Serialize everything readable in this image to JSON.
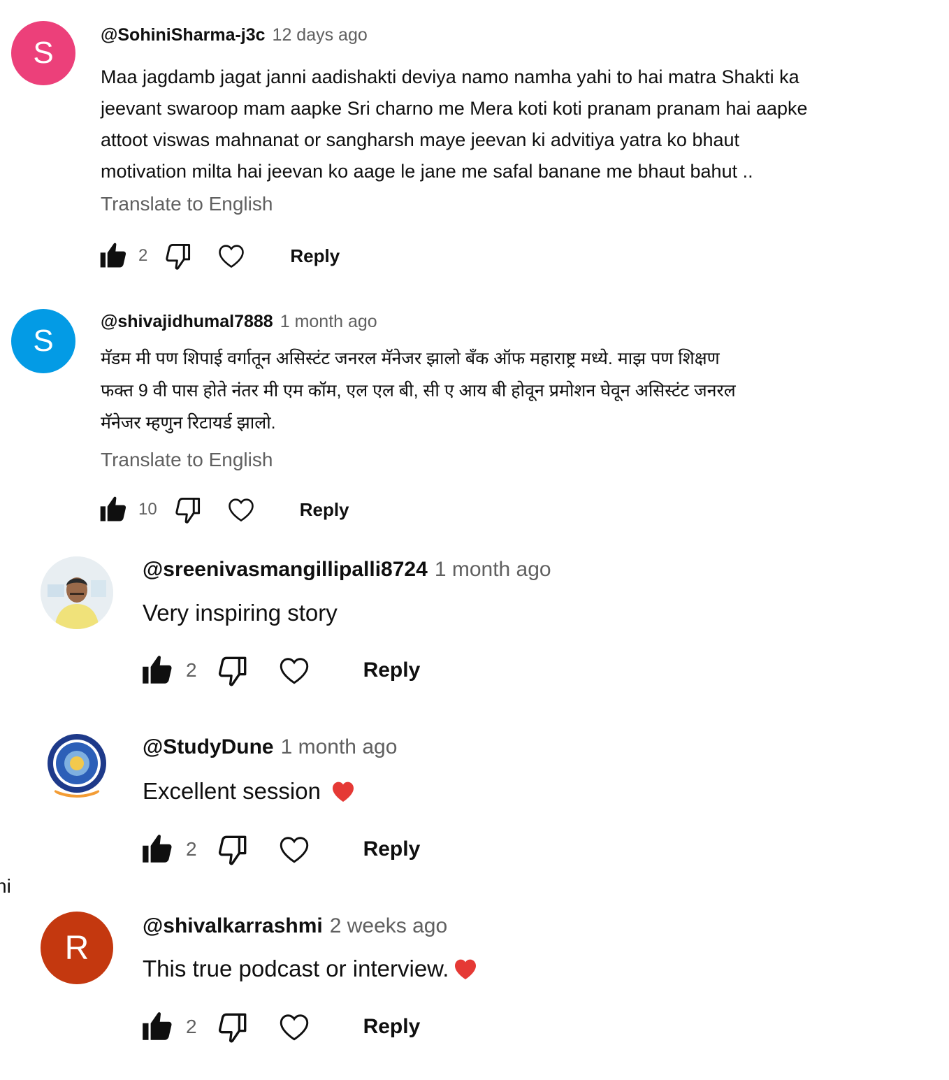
{
  "comments": [
    {
      "avatar_letter": "S",
      "avatar_color": "#ec407a",
      "author": "@SohiniSharma-j3c",
      "time": "12 days ago",
      "lines": [
        "Maa jagdamb jagat janni  aadishakti deviya namo namha yahi to hai matra Shakti ka",
        "jeevant swaroop mam aapke Sri charno  me  Mera koti koti pranam pranam hai aapke",
        "attoot viswas mahnanat  or sangharsh maye jeevan ki advitiya yatra ko bhaut",
        "motivation milta hai jeevan ko aage le jane me safal banane me bhaut bahut .."
      ],
      "translate": "Translate to English",
      "likes": "2",
      "reply": "Reply"
    },
    {
      "avatar_letter": "S",
      "avatar_color": "#039be5",
      "author": "@shivajidhumal7888",
      "time": "1 month ago",
      "lines": [
        "मॅडम मी पण शिपाई वर्गातून असिस्टंट जनरल मॅनेजर झालो बँक ऑफ महाराष्ट्र मध्ये. माझ पण शिक्षण",
        "फक्त 9 वी पास होते नंतर मी एम कॉम, एल एल बी, सी ए आय बी होवून प्रमोशन घेवून असिस्टंट जनरल",
        "मॅनेजर म्हणुन रिटायर्ड झालो."
      ],
      "translate": "Translate to English",
      "likes": "10",
      "reply": "Reply"
    }
  ],
  "replies": [
    {
      "avatar_kind": "photo",
      "author": "@sreenivasmangillipalli8724",
      "time": "1 month ago",
      "text": "Very inspiring story",
      "likes": "2",
      "reply": "Reply"
    },
    {
      "avatar_kind": "logo",
      "author": "@StudyDune",
      "time": "1 month ago",
      "text": "Excellent session",
      "likes": "2",
      "reply": "Reply"
    },
    {
      "avatar_kind": "letter",
      "avatar_letter": "R",
      "avatar_color": "#c4380f",
      "author": "@shivalkarrashmi",
      "time": "2 weeks ago",
      "text": "This true podcast or interview.",
      "likes": "2",
      "reply": "Reply"
    }
  ],
  "left_clip_text": "ni",
  "heart_emoji_color": "#e53935"
}
